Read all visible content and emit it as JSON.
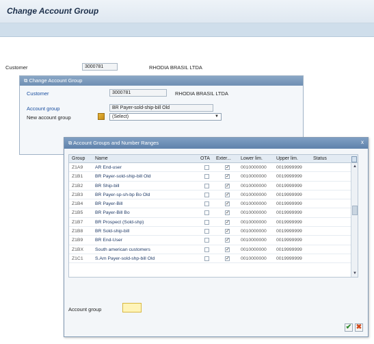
{
  "screen": {
    "title": "Change Account Group",
    "customer_label": "Customer",
    "customer_value": "3000781",
    "customer_name": "RHODIA BRASIL LTDA"
  },
  "change_dialog": {
    "title": "Change Account Group",
    "customer_label": "Customer",
    "customer_value": "3000781",
    "customer_name": "RHODIA BRASIL LTDA",
    "account_group_label": "Account group",
    "account_group_value": "BR Payer-sold-ship-bill Old",
    "new_account_group_label": "New account group",
    "new_account_group_value": "(Select)"
  },
  "groups_dialog": {
    "title": "Account Groups and Number Ranges",
    "columns": [
      "Group",
      "Name",
      "OTA",
      "Exter...",
      "Lower lim.",
      "Upper lim.",
      "Status"
    ],
    "rows": [
      {
        "group": "Z1A9",
        "name": "AR End-user",
        "ota": false,
        "ext": true,
        "lower": "0010000000",
        "upper": "0019999999"
      },
      {
        "group": "Z1B1",
        "name": "BR Payer-sold-ship-bill Old",
        "ota": false,
        "ext": true,
        "lower": "0010000000",
        "upper": "0019999999"
      },
      {
        "group": "Z1B2",
        "name": "BR Ship-bill",
        "ota": false,
        "ext": true,
        "lower": "0010000000",
        "upper": "0019999999"
      },
      {
        "group": "Z1B3",
        "name": "BR Payer-sp-sh-bp Bo Old",
        "ota": false,
        "ext": true,
        "lower": "0010000000",
        "upper": "0019999999"
      },
      {
        "group": "Z1B4",
        "name": "BR Payer-Bill",
        "ota": false,
        "ext": true,
        "lower": "0010000000",
        "upper": "0019999999"
      },
      {
        "group": "Z1B5",
        "name": "BR Payer-Bill Bo",
        "ota": false,
        "ext": true,
        "lower": "0010000000",
        "upper": "0019999999"
      },
      {
        "group": "Z1B7",
        "name": "BR Prospect (Sold-shp)",
        "ota": false,
        "ext": true,
        "lower": "0010000000",
        "upper": "0019999999"
      },
      {
        "group": "Z1B8",
        "name": "BR Sold-ship-bill",
        "ota": false,
        "ext": true,
        "lower": "0010000000",
        "upper": "0019999999"
      },
      {
        "group": "Z1B9",
        "name": "BR End-User",
        "ota": false,
        "ext": true,
        "lower": "0010000000",
        "upper": "0019999999"
      },
      {
        "group": "Z1BX",
        "name": "South american customers",
        "ota": false,
        "ext": true,
        "lower": "0010000000",
        "upper": "0019999999"
      },
      {
        "group": "Z1C1",
        "name": "S.Am Payer-sold-shp-bill Old",
        "ota": false,
        "ext": true,
        "lower": "0010000000",
        "upper": "0019999999"
      }
    ],
    "account_group_label": "Account group",
    "close_symbol": "x"
  },
  "colors": {
    "accent": "#5f82ab",
    "ok": "#2f8a2f",
    "cancel": "#d24a1a",
    "required_field": "#fff4b8"
  }
}
